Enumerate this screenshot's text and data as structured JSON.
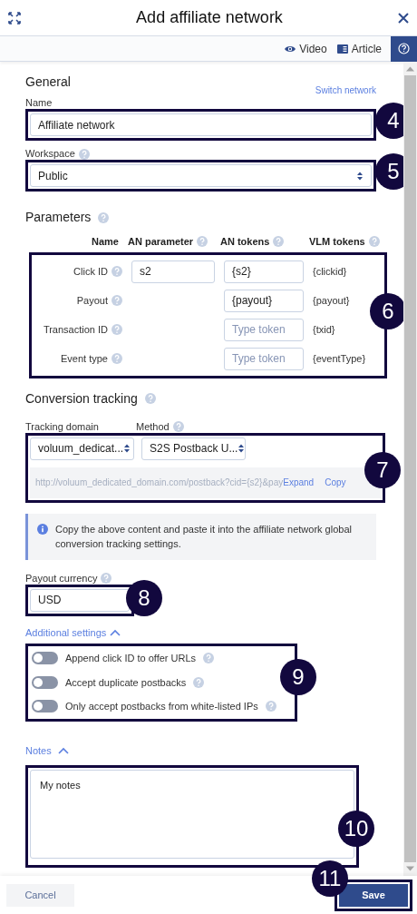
{
  "header": {
    "title": "Add affiliate network"
  },
  "toolbar": {
    "links": [
      "Video",
      "Article"
    ]
  },
  "general": {
    "heading": "General",
    "switch_link": "Switch network",
    "name": {
      "label": "Name",
      "value": "Affiliate network",
      "callout": "4"
    },
    "workspace": {
      "label": "Workspace",
      "value": "Public",
      "callout": "5"
    }
  },
  "parameters": {
    "heading": "Parameters",
    "callout": "6",
    "columns": [
      {
        "label": "Name",
        "help": false
      },
      {
        "label": "AN parameter",
        "help": true
      },
      {
        "label": "AN tokens",
        "help": true
      },
      {
        "label": "VLM tokens",
        "help": true
      }
    ],
    "rows": [
      {
        "name": "Click ID",
        "an_parameter": "s2",
        "an_token": {
          "value": "{s2}"
        },
        "vlm_token": "{clickid}"
      },
      {
        "name": "Payout",
        "an_token": {
          "value": "{payout}"
        },
        "vlm_token": "{payout}"
      },
      {
        "name": "Transaction ID",
        "an_token": {
          "placeholder": "Type token"
        },
        "vlm_token": "{txid}"
      },
      {
        "name": "Event type",
        "an_token": {
          "placeholder": "Type token"
        },
        "vlm_token": "{eventType}"
      }
    ]
  },
  "conversion_tracking": {
    "heading": "Conversion tracking",
    "callout": "7",
    "tracking_domain": {
      "label": "Tracking domain",
      "value": "voluum_dedicat..."
    },
    "method": {
      "label": "Method",
      "value": "S2S Postback U..."
    },
    "url": "http://voluum_dedicated_domain.com/postback?cid={s2}&pay",
    "expand": "Expand",
    "copy": "Copy",
    "info": "Copy the above content and paste it into the affiliate network global conversion tracking settings."
  },
  "payout_currency": {
    "label": "Payout currency",
    "value": "USD",
    "callout": "8"
  },
  "additional_settings": {
    "label": "Additional settings",
    "expanded": true,
    "callout": "9",
    "toggles": [
      {
        "label": "Append click ID to offer URLs",
        "on": false
      },
      {
        "label": "Accept duplicate postbacks",
        "on": false
      },
      {
        "label": "Only accept postbacks from white-listed IPs",
        "on": false
      }
    ]
  },
  "notes": {
    "label": "Notes",
    "expanded": true,
    "value": "My notes",
    "callout": "10"
  },
  "footer": {
    "cancel": "Cancel",
    "save": "Save",
    "callout": "11"
  }
}
